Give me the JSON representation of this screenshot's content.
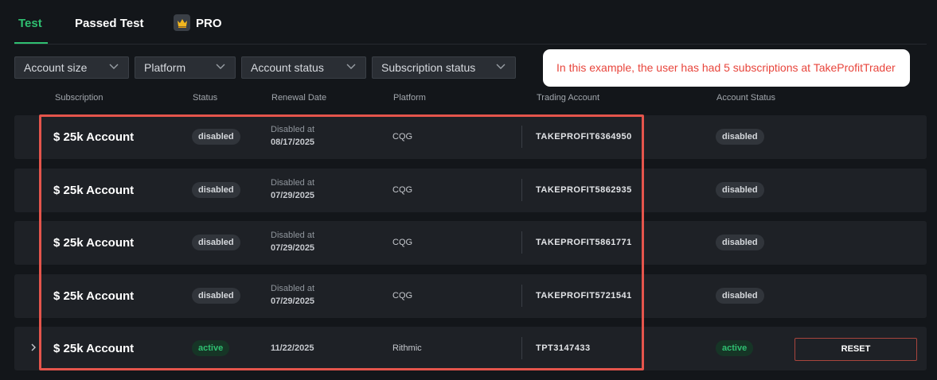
{
  "tabs": [
    {
      "label": "Test",
      "active": true
    },
    {
      "label": "Passed Test",
      "active": false
    },
    {
      "label": "PRO",
      "active": false,
      "icon": "crown-icon"
    }
  ],
  "filters": [
    {
      "label": "Account size"
    },
    {
      "label": "Platform"
    },
    {
      "label": "Account status"
    },
    {
      "label": "Subscription status"
    }
  ],
  "annotation": "In this example, the user has had 5 subscriptions at TakeProfitTrader",
  "columns": {
    "subscription": "Subscription",
    "status": "Status",
    "renewal": "Renewal Date",
    "platform": "Platform",
    "trading_account": "Trading Account",
    "account_status": "Account Status"
  },
  "rows": [
    {
      "subscription": "$ 25k Account",
      "status": "disabled",
      "renewal_label": "Disabled at",
      "renewal_date": "08/17/2025",
      "platform": "CQG",
      "trading_account": "TAKEPROFIT6364950",
      "account_status": "disabled"
    },
    {
      "subscription": "$ 25k Account",
      "status": "disabled",
      "renewal_label": "Disabled at",
      "renewal_date": "07/29/2025",
      "platform": "CQG",
      "trading_account": "TAKEPROFIT5862935",
      "account_status": "disabled"
    },
    {
      "subscription": "$ 25k Account",
      "status": "disabled",
      "renewal_label": "Disabled at",
      "renewal_date": "07/29/2025",
      "platform": "CQG",
      "trading_account": "TAKEPROFIT5861771",
      "account_status": "disabled"
    },
    {
      "subscription": "$ 25k Account",
      "status": "disabled",
      "renewal_label": "Disabled at",
      "renewal_date": "07/29/2025",
      "platform": "CQG",
      "trading_account": "TAKEPROFIT5721541",
      "account_status": "disabled"
    },
    {
      "subscription": "$ 25k Account",
      "status": "active",
      "renewal_label": "",
      "renewal_date": "11/22/2025",
      "platform": "Rithmic",
      "trading_account": "TPT3147433",
      "account_status": "active",
      "action_label": "RESET"
    }
  ],
  "colors": {
    "accent": "#2fbf71",
    "background": "#13161a",
    "row": "#1e2126",
    "highlight": "#e5554c",
    "annotation_text": "#e8453c"
  }
}
